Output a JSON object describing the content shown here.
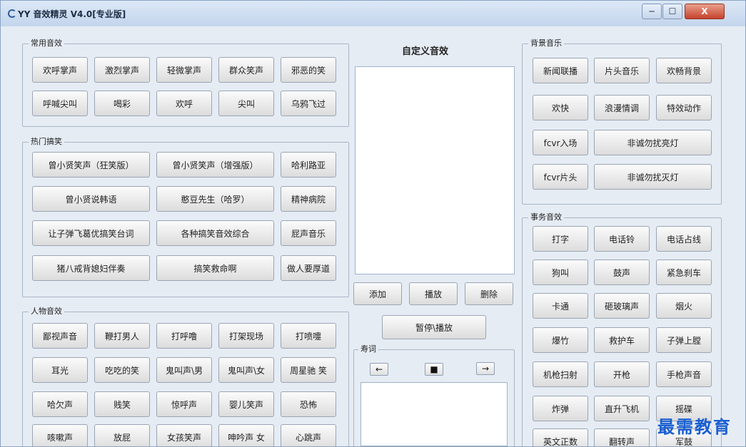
{
  "window": {
    "title": "YY 音效精灵 V4.0[专业版]"
  },
  "window_controls": {
    "minimize": "─",
    "maximize": "☐",
    "close": "X"
  },
  "groups": {
    "common": {
      "title": "常用音效",
      "buttons": [
        "欢呼掌声",
        "激烈掌声",
        "轻微掌声",
        "群众笑声",
        "邪恶的笑",
        "呼喊尖叫",
        "喝彩",
        "欢呼",
        "尖叫",
        "乌鸦飞过"
      ]
    },
    "hot": {
      "title": "热门搞笑",
      "buttons": [
        "曾小贤笑声（狂笑版）",
        "曾小贤笑声（增强版）",
        "哈利路亚",
        "曾小贤说韩语",
        "憨豆先生（哈罗）",
        "精神病院",
        "让子弹飞葛优搞笑台词",
        "各种搞笑音效综合",
        "屁声音乐",
        "猪八戒背媳妇伴奏",
        "搞笑救命啊",
        "做人要厚道"
      ]
    },
    "people": {
      "title": "人物音效",
      "buttons": [
        "鄙视声音",
        "鞭打男人",
        "打呼噜",
        "打架现场",
        "打喷嚏",
        "耳光",
        "吃吃的笑",
        "鬼叫声\\男",
        "鬼叫声\\女",
        "周星驰 笑",
        "哈欠声",
        "贱笑",
        "惊呼声",
        "婴儿笑声",
        "恐怖",
        "咳嗽声",
        "放屁",
        "女孩笑声",
        "呻吟声 女",
        "心跳声"
      ]
    },
    "bgm": {
      "title": "背景音乐",
      "buttons": [
        "新闻联播",
        "片头音乐",
        "欢畅背景",
        "欢快",
        "浪漫情调",
        "特效动作",
        "fcvr入场",
        "非诚勿扰亮灯",
        "fcvr片头",
        "非诚勿扰灭灯"
      ]
    },
    "misc": {
      "title": "事务音效",
      "buttons": [
        "打字",
        "电话铃",
        "电话占线",
        "狗叫",
        "鼓声",
        "紧急刹车",
        "卡通",
        "砸玻璃声",
        "烟火",
        "爆竹",
        "救护车",
        "子弹上膛",
        "机枪扫射",
        "开枪",
        "手枪声音",
        "炸弹",
        "直升飞机",
        "摇碟",
        "英文正数",
        "翻转声",
        "军鼓"
      ]
    }
  },
  "custom": {
    "title": "自定义音效",
    "add": "添加",
    "play": "播放",
    "delete": "删除",
    "pause_play": "暂停\\播放"
  },
  "lyrics": {
    "title": "寿词",
    "prev": "←",
    "stop": "■",
    "next": "→"
  },
  "watermark": "最需教育"
}
